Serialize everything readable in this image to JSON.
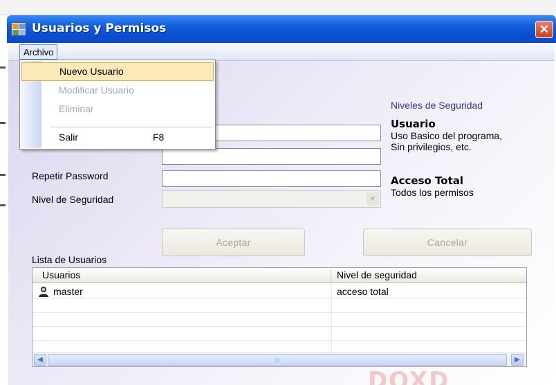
{
  "window": {
    "title": "Usuarios y Permisos",
    "close_glyph": "✕"
  },
  "menubar": {
    "archivo": "Archivo"
  },
  "archivo_menu": {
    "items": [
      {
        "label": "Nuevo Usuario",
        "shortcut": "",
        "state": "highlighted"
      },
      {
        "label": "Modificar Usuario",
        "shortcut": "",
        "state": "disabled"
      },
      {
        "label": "Eliminar",
        "shortcut": "",
        "state": "disabled"
      },
      {
        "label": "Salir",
        "shortcut": "F8",
        "state": "enabled"
      }
    ]
  },
  "form": {
    "repetir_password_label": "Repetir Password",
    "nivel_seguridad_label": "Nivel de Seguridad",
    "nivel_seguridad_value": "",
    "aceptar_label": "Aceptar",
    "cancelar_label": "Cancelar",
    "lista_label": "Lista de Usuarios"
  },
  "security_panel": {
    "title": "Niveles de Seguridad",
    "usuario_heading": "Usuario",
    "usuario_desc_1": "Uso Basico del programa,",
    "usuario_desc_2": "Sin privilegios, etc.",
    "acceso_heading": "Acceso Total",
    "acceso_desc": "Todos los permisos"
  },
  "users_list": {
    "columns": [
      "Usuarios",
      "Nivel de seguridad"
    ],
    "rows": [
      {
        "usuario": "master",
        "nivel": "acceso total",
        "icon": "user-icon"
      }
    ]
  },
  "scrollbar": {
    "left_glyph": "◀",
    "right_glyph": "▶",
    "thumb_glyph": "|||"
  },
  "watermark": "DOXD",
  "colors": {
    "titlebar": "#0a4fd2",
    "highlight": "#fbe9b8",
    "panel_title": "#2c3b9a"
  }
}
